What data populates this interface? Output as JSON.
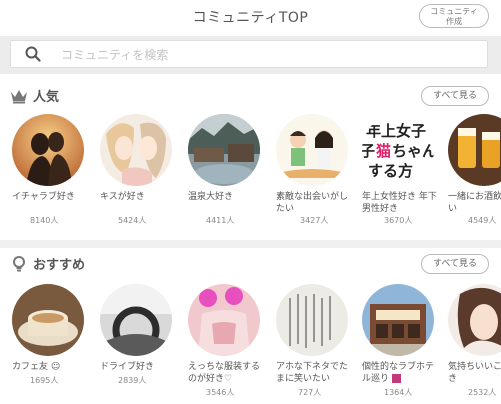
{
  "header": {
    "title": "コミュニティTOP",
    "create_label": "コミュニティ\n作成"
  },
  "search": {
    "placeholder": "コミュニティを検索"
  },
  "popular": {
    "title": "人気",
    "see_all": "すべて見る",
    "items": [
      {
        "name": "イチャラブ好き",
        "count": "8140人"
      },
      {
        "name": "キスが好き",
        "count": "5424人"
      },
      {
        "name": "温泉大好き",
        "count": "4411人"
      },
      {
        "name": "素敵な出会いがしたい",
        "count": "3427人"
      },
      {
        "name": "年上女性好き 年下男性好き",
        "count": "3670人"
      },
      {
        "name": "一緒にお酒飲みたい",
        "count": "4549人"
      }
    ]
  },
  "recommended": {
    "title": "おすすめ",
    "see_all": "すべて見る",
    "items": [
      {
        "name": "カフェ友",
        "count": "1695人"
      },
      {
        "name": "ドライブ好き",
        "count": "2839人"
      },
      {
        "name": "えっちな服装するのが好き♡",
        "count": "3546人"
      },
      {
        "name": "アホな下ネタでたまに笑いたい",
        "count": "727人"
      },
      {
        "name": "個性的なラブホテル巡り",
        "count": "1364人"
      },
      {
        "name": "気持ちいいこと好き",
        "count": "2532人"
      }
    ]
  }
}
